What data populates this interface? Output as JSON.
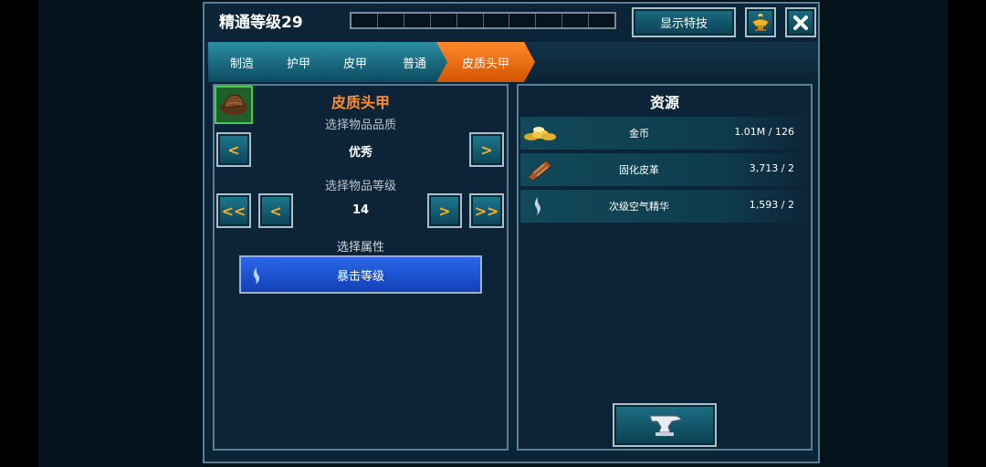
{
  "header": {
    "title": "精通等级29",
    "xp_segments": 10,
    "xp_progress": 0,
    "show_skills_label": "显示特技"
  },
  "tabs": [
    {
      "label": "制造"
    },
    {
      "label": "护甲"
    },
    {
      "label": "皮甲"
    },
    {
      "label": "普通"
    },
    {
      "label": "皮质头甲",
      "active": true
    }
  ],
  "item": {
    "name": "皮质头甲",
    "quality_label": "选择物品品质",
    "quality_value": "优秀",
    "level_label": "选择物品等级",
    "level_value": "14",
    "attribute_label": "选择属性",
    "attribute_value": "暴击等级"
  },
  "resources": {
    "title": "资源",
    "items": [
      {
        "name": "金币",
        "value": "1.01M / 126",
        "icon": "gold-coins-icon"
      },
      {
        "name": "固化皮革",
        "value": "3,713 / 2",
        "icon": "cured-leather-icon"
      },
      {
        "name": "次级空气精华",
        "value": "1,593 / 2",
        "icon": "air-essence-icon"
      }
    ]
  },
  "colors": {
    "accent_orange": "#ff8c30",
    "tab_active": "#ff7a1a",
    "attribute_button": "#1f56d8"
  }
}
